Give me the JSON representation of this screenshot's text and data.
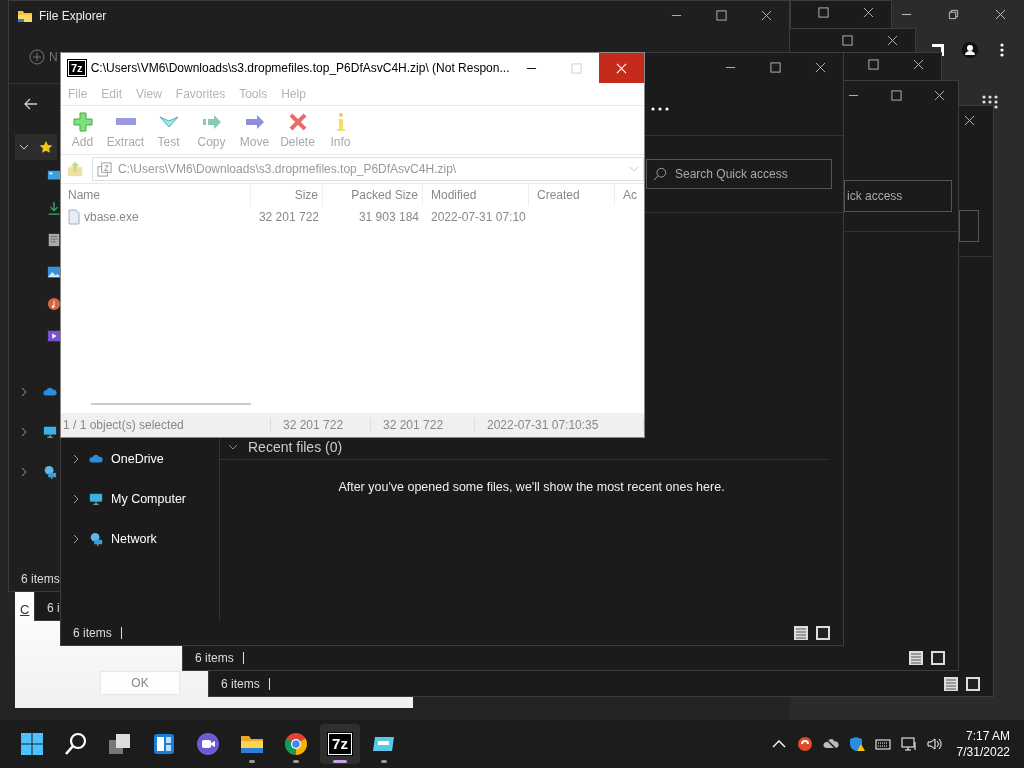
{
  "file_explorer": {
    "title": "File Explorer",
    "toolbar_partial": "N",
    "status": "6 items"
  },
  "dialog": {
    "link_partial": "C",
    "button": "OK"
  },
  "stacked_explorers": [
    {
      "status": "6 i"
    },
    {
      "status": "6 items"
    },
    {
      "status": "6 items",
      "search_placeholder": "ick access"
    }
  ],
  "explorer_front": {
    "search_placeholder": "Search Quick access",
    "nav_items": [
      {
        "label": "OneDrive",
        "kind": "cloud"
      },
      {
        "label": "My Computer",
        "kind": "computer"
      },
      {
        "label": "Network",
        "kind": "network"
      }
    ],
    "section_title": "Recent files (0)",
    "empty_message": "After you've opened some files, we'll show the most recent ones here.",
    "status": "6 items"
  },
  "archive_window": {
    "icon_text": "7z",
    "title": "C:\\Users\\VM6\\Downloads\\s3.dropmefiles.top_P6DfAsvC4H.zip\\ (Not Respon...",
    "menu": [
      {
        "label": "File",
        "disabled": true
      },
      {
        "label": "Edit",
        "disabled": true
      },
      {
        "label": "View",
        "disabled": true
      },
      {
        "label": "Favorites",
        "disabled": true
      },
      {
        "label": "Tools",
        "disabled": true
      },
      {
        "label": "Help",
        "disabled": true
      }
    ],
    "tools": [
      {
        "label": "Add",
        "kind": "add",
        "disabled": true
      },
      {
        "label": "Extract",
        "kind": "extract",
        "disabled": true
      },
      {
        "label": "Test",
        "kind": "test",
        "disabled": true
      },
      {
        "label": "Copy",
        "kind": "copy",
        "disabled": true
      },
      {
        "label": "Move",
        "kind": "move",
        "disabled": true
      },
      {
        "label": "Delete",
        "kind": "delete",
        "disabled": true
      },
      {
        "label": "Info",
        "kind": "info",
        "disabled": true
      }
    ],
    "address": "C:\\Users\\VM6\\Downloads\\s3.dropmefiles.top_P6DfAsvC4H.zip\\",
    "columns": [
      "Name",
      "Size",
      "Packed Size",
      "Modified",
      "Created",
      "Ac"
    ],
    "rows": [
      {
        "cells": [
          "vbase.exe",
          "32 201 722",
          "31 903 184",
          "2022-07-31 07:10"
        ]
      }
    ],
    "status": [
      "1 / 1 object(s) selected",
      "32 201 722",
      "32 201 722",
      "2022-07-31 07:10:35"
    ]
  },
  "taskbar": {
    "apps": [
      {
        "kind": "start",
        "running": false,
        "selected": false
      },
      {
        "kind": "search",
        "running": false,
        "selected": false
      },
      {
        "kind": "task-view",
        "running": false,
        "selected": false
      },
      {
        "kind": "widgets",
        "running": false,
        "selected": false
      },
      {
        "kind": "chat",
        "running": false,
        "selected": false
      },
      {
        "kind": "folder",
        "running": true,
        "selected": false
      },
      {
        "kind": "browser",
        "running": true,
        "selected": false
      },
      {
        "kind": "archiver",
        "label": "7z",
        "running": true,
        "selected": true
      },
      {
        "kind": "monitor",
        "running": true,
        "selected": false
      }
    ],
    "time": "7:17 AM",
    "date": "7/31/2022"
  }
}
